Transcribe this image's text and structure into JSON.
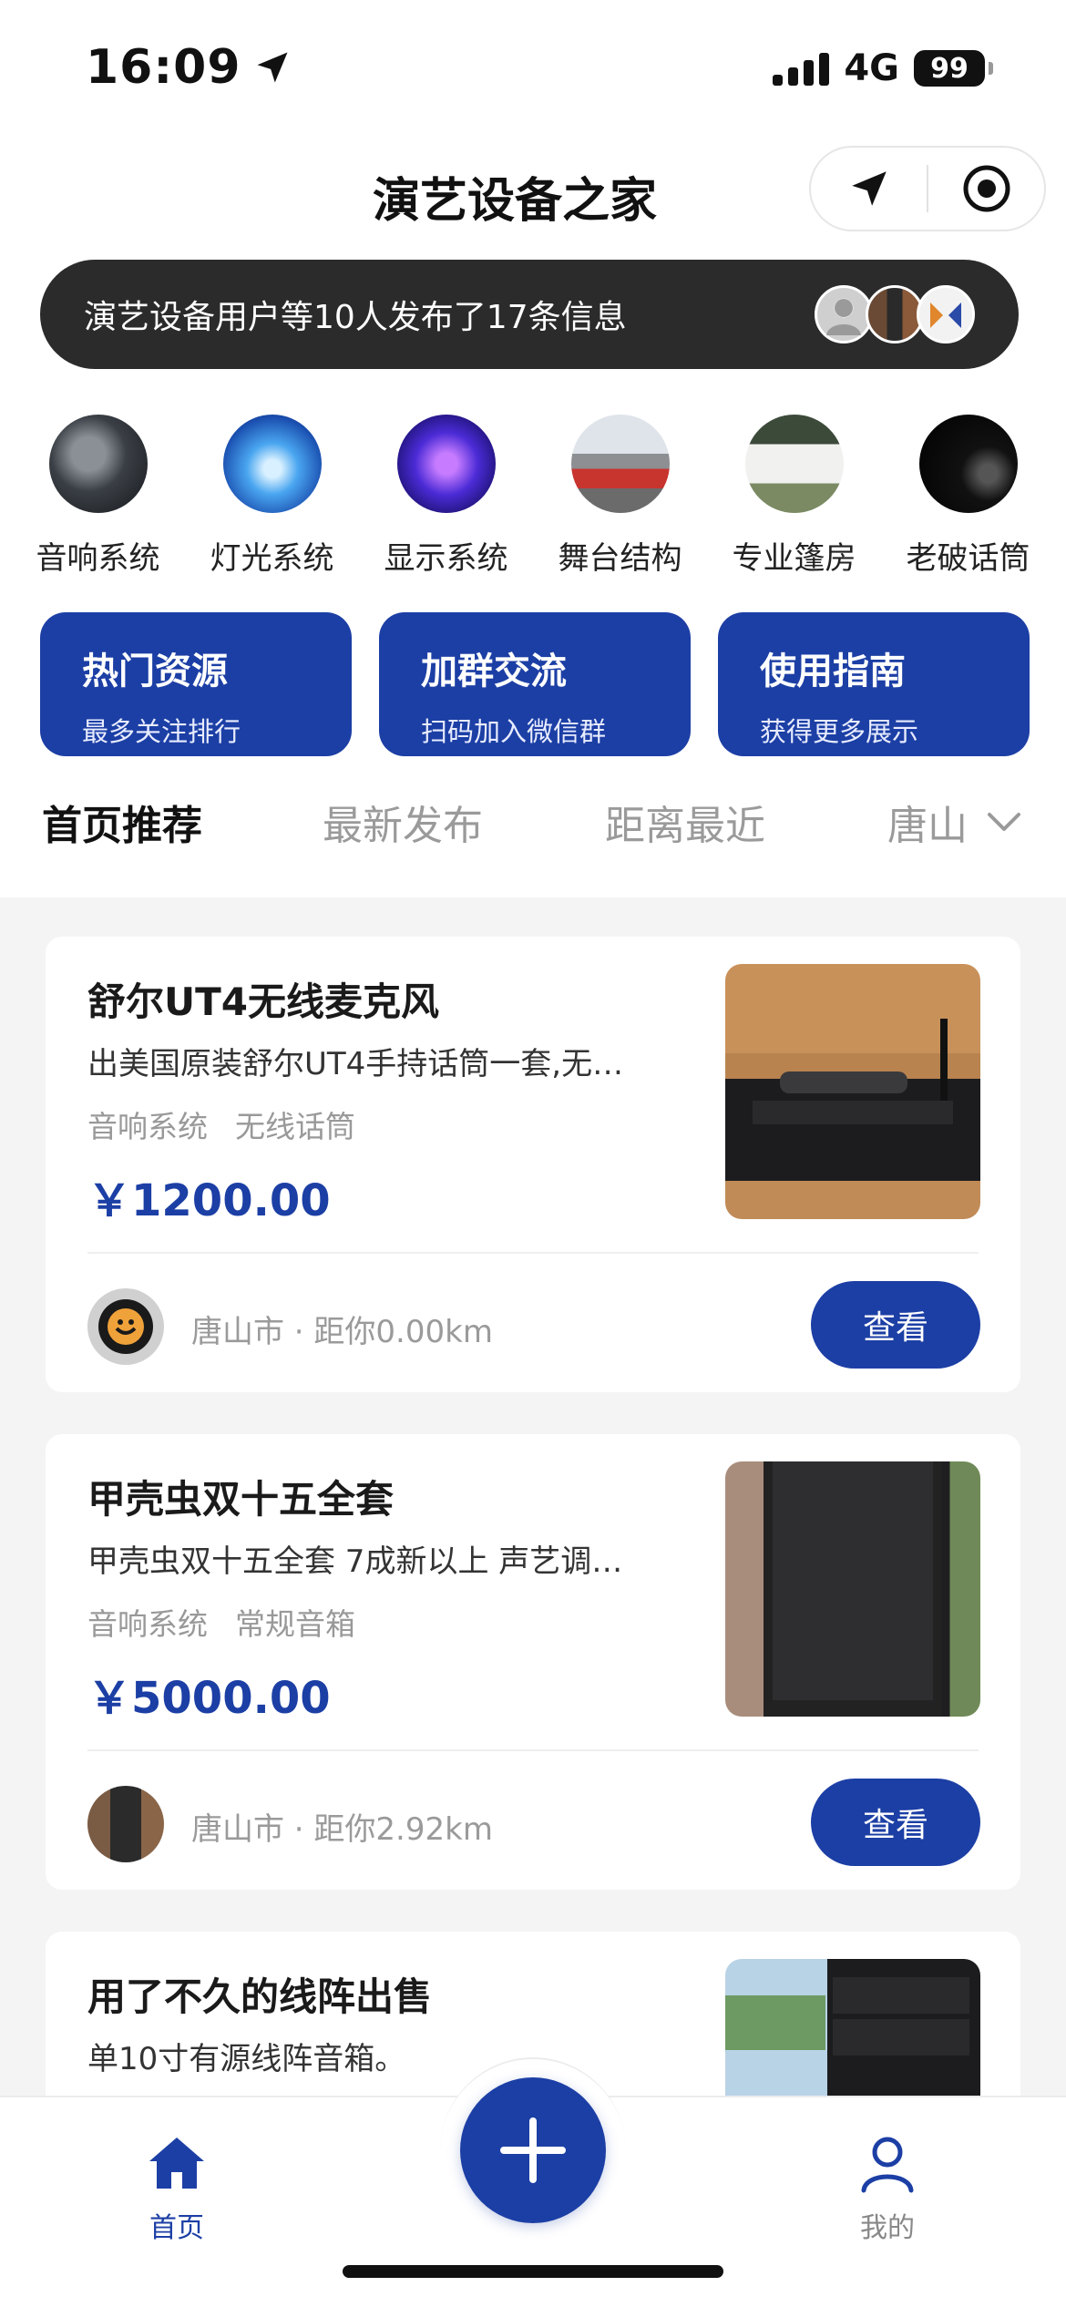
{
  "status_bar": {
    "time": "16:09",
    "network": "4G",
    "battery": "99"
  },
  "header": {
    "title": "演艺设备之家"
  },
  "capsule": {
    "icons": [
      "location-arrow-icon",
      "record-icon"
    ]
  },
  "banner": {
    "text": "演艺设备用户等10人发布了17条信息"
  },
  "categories": [
    {
      "label": "音响系统",
      "icon": "mixer-photo"
    },
    {
      "label": "灯光系统",
      "icon": "stage-lights-photo"
    },
    {
      "label": "显示系统",
      "icon": "led-screen-photo"
    },
    {
      "label": "舞台结构",
      "icon": "truss-photo"
    },
    {
      "label": "专业篷房",
      "icon": "tent-photo"
    },
    {
      "label": "老破话筒",
      "icon": "microphone-photo"
    }
  ],
  "features": [
    {
      "title": "热门资源",
      "sub": "最多关注排行"
    },
    {
      "title": "加群交流",
      "sub": "扫码加入微信群"
    },
    {
      "title": "使用指南",
      "sub": "获得更多展示"
    }
  ],
  "tabs": {
    "items": [
      "首页推荐",
      "最新发布",
      "距离最近"
    ],
    "city": "唐山",
    "active": "首页推荐"
  },
  "listings": [
    {
      "title": "舒尔UT4无线麦克风",
      "desc": "出美国原装舒尔UT4手持话筒一套,无…",
      "tags": [
        "音响系统",
        "无线话筒"
      ],
      "price": "￥1200.00",
      "location": "唐山市 · 距你0.00km",
      "action": "查看"
    },
    {
      "title": "甲壳虫双十五全套",
      "desc": "甲壳虫双十五全套 7成新以上 声艺调…",
      "tags": [
        "音响系统",
        "常规音箱"
      ],
      "price": "￥5000.00",
      "location": "唐山市 · 距你2.92km",
      "action": "查看"
    },
    {
      "title": "用了不久的线阵出售",
      "desc": "单10寸有源线阵音箱。",
      "tags": [],
      "price": "",
      "location": "",
      "action": ""
    }
  ],
  "tabbar": {
    "home": "首页",
    "mine": "我的",
    "accent": "#1c3fa5"
  }
}
